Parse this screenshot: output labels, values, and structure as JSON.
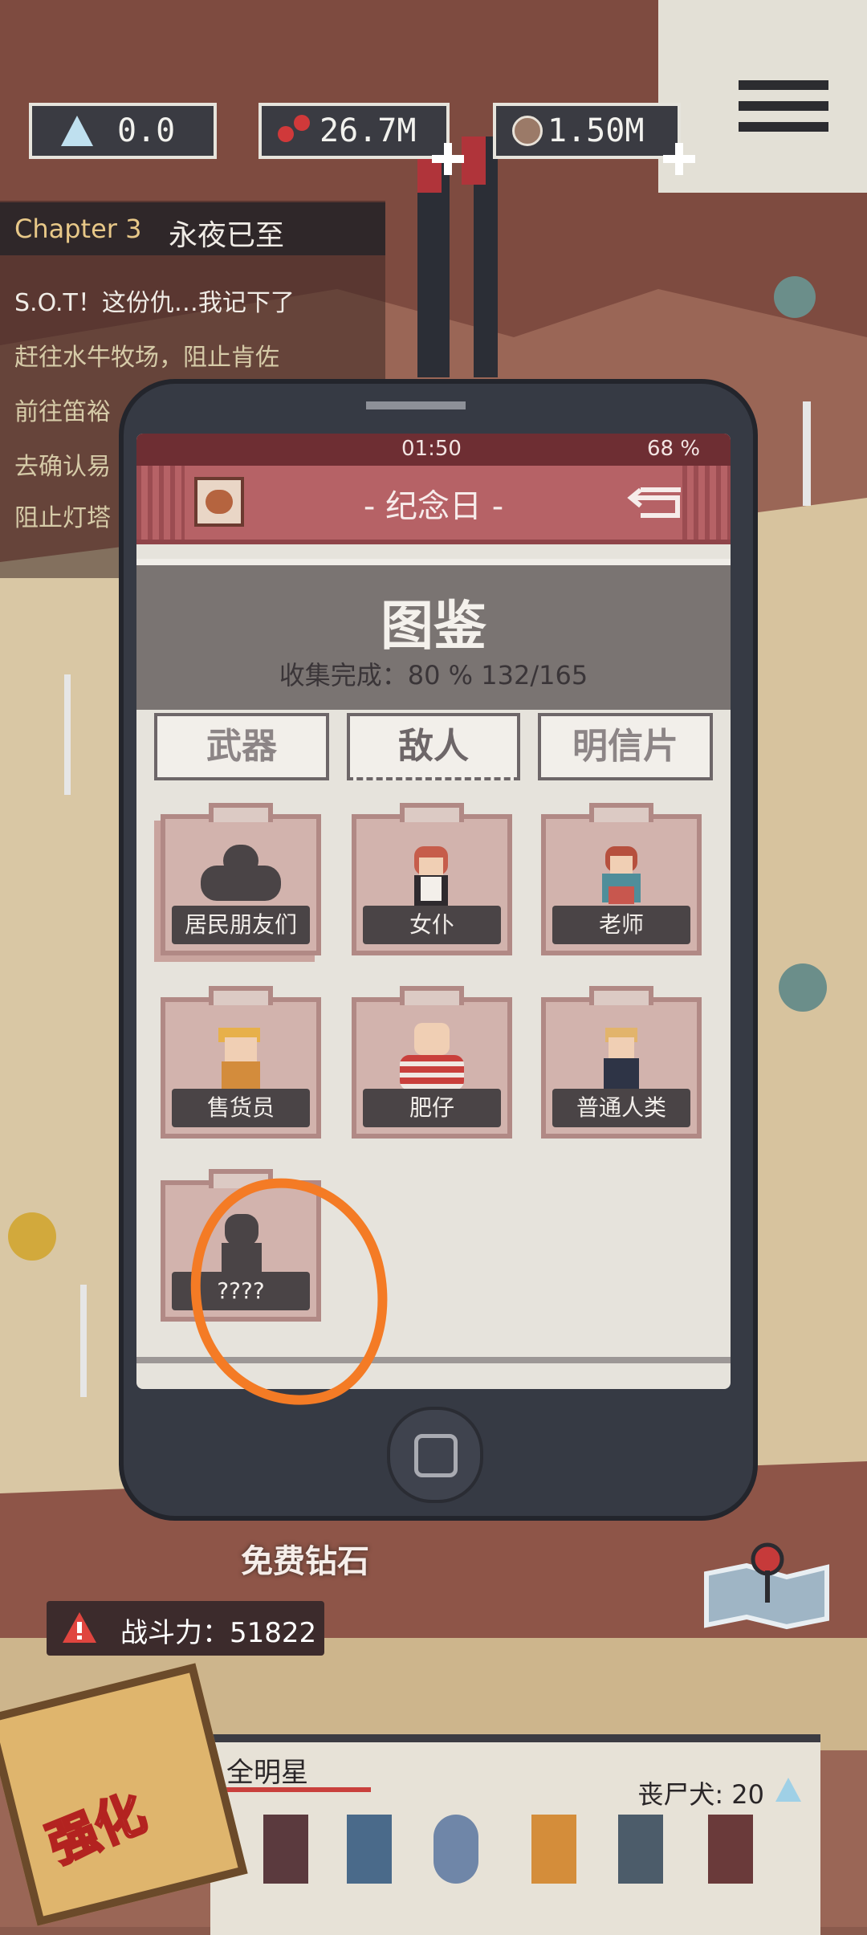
{
  "resources": [
    {
      "icon": "gem-icon",
      "value": "0.0"
    },
    {
      "icon": "tokens-icon",
      "value": "26.7M"
    },
    {
      "icon": "meat-icon",
      "value": "1.50M"
    }
  ],
  "quest_log": {
    "chapter_label": "Chapter 3",
    "chapter_title": "永夜已至",
    "lines": [
      "S.O.T！这份仇…我记下了",
      "赶往水牛牧场，阻止肯佐",
      "前往笛裕",
      "去确认易",
      "阻止灯塔"
    ]
  },
  "phone": {
    "time": "01:50",
    "battery": "68 %",
    "header_title": "- 纪念日 -",
    "page_title": "图鉴",
    "progress": "收集完成：80 %  132/165",
    "tabs": [
      "武器",
      "敌人",
      "明信片"
    ],
    "active_tab": "敌人",
    "cards": [
      "居民朋友们",
      "女仆",
      "老师",
      "售货员",
      "肥仔",
      "普通人类",
      "????"
    ]
  },
  "free_diamonds": "免费钻石",
  "combat_power": "战斗力：51822",
  "squad": {
    "title": "全明星",
    "count": "丧尸犬: 20"
  },
  "enhance_label": "强化",
  "colors": {
    "accent": "#b66266",
    "highlight_circle": "#f47b25",
    "panel": "#3a3b42"
  }
}
